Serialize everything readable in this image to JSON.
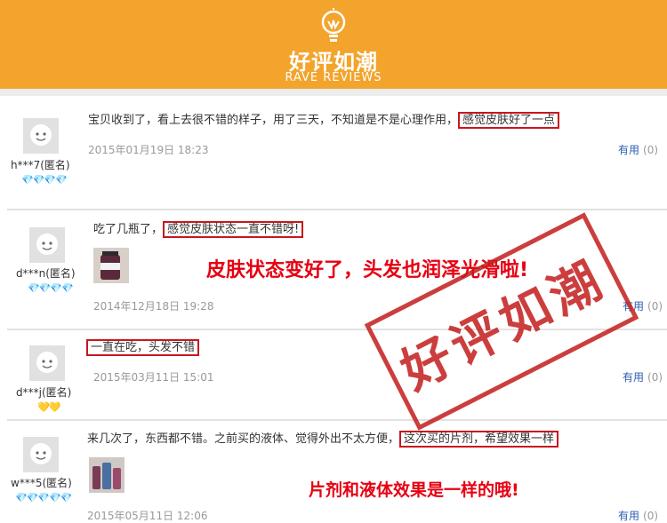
{
  "header": {
    "title": "好评如潮",
    "subtitle": "RAVE REVIEWS",
    "icon": "lightbulb-icon"
  },
  "reviews": [
    {
      "user": "h***7(匿名)",
      "hearts": "💎💎💎💎",
      "text_before": "宝贝收到了，看上去很不错的样子，用了三天，不知道是不是心理作用，",
      "text_boxed": "感觉皮肤好了一点",
      "text_after": "",
      "date": "2015年01月19日 18:23",
      "helpful": "有用",
      "count": "(0)"
    },
    {
      "user": "d***n(匿名)",
      "hearts": "💎💎💎💎",
      "text_before": "吃了几瓶了，",
      "text_boxed": "感觉皮肤状态一直不错呀!",
      "text_after": "",
      "date": "2014年12月18日 19:28",
      "helpful": "有用",
      "count": "(0)"
    },
    {
      "user": "d***j(匿名)",
      "hearts": "💛💛",
      "text_before": "",
      "text_boxed": "一直在吃，头发不错",
      "text_after": "",
      "date": "2015年03月11日 15:01",
      "helpful": "有用",
      "count": "(0)"
    },
    {
      "user": "w***5(匿名)",
      "hearts": "💎💎💎💎💎",
      "text_before": "来几次了，东西都不错。之前买的液体、觉得外出不太方便，",
      "text_boxed": "这次买的片剂，希望效果一样",
      "text_after": "",
      "date": "2015年05月11日 12:06",
      "helpful": "有用",
      "count": "(0)"
    }
  ],
  "annotations": {
    "a1": "皮肤状态变好了，头发也润泽光滑啦!",
    "a2": "片剂和液体效果是一样的哦!"
  },
  "stamp": "好评如潮",
  "colors": {
    "header_bg": "#f3a42c",
    "box_red": "#c8161d",
    "anno_red": "#e60012",
    "link_blue": "#2a5db0"
  }
}
